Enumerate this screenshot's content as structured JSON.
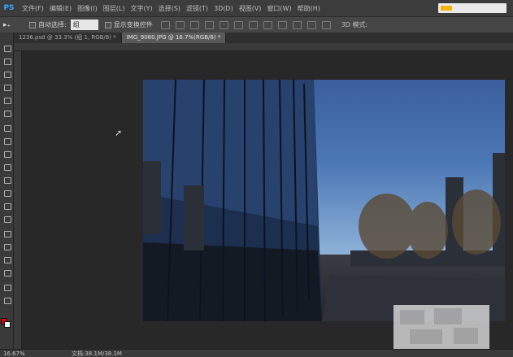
{
  "app": {
    "logo": "PS"
  },
  "menu": {
    "items": [
      "文件(F)",
      "编辑(E)",
      "图像(I)",
      "图层(L)",
      "文字(Y)",
      "选择(S)",
      "滤镜(T)",
      "3D(D)",
      "视图(V)",
      "窗口(W)",
      "帮助(H)"
    ]
  },
  "options": {
    "tool_glyph": "▸₊",
    "auto_select_label": "自动选择:",
    "auto_select_value": "组",
    "show_transform_label": "显示变换控件",
    "mode_3d_label": "3D 模式:"
  },
  "tabs": [
    {
      "label": "1236.psd @ 33.3% (组 1, RGB/8) *",
      "active": false
    },
    {
      "label": "IMG_9060.JPG @ 16.7%(RGB/8) *",
      "active": true
    }
  ],
  "tools": [
    "move-icon",
    "marquee-icon",
    "lasso-icon",
    "quick-select-icon",
    "crop-icon",
    "eyedropper-icon",
    "healing-brush-icon",
    "brush-icon",
    "clone-stamp-icon",
    "history-brush-icon",
    "eraser-icon",
    "gradient-icon",
    "blur-icon",
    "dodge-icon",
    "pen-icon",
    "type-icon",
    "path-select-icon",
    "shape-icon",
    "hand-icon",
    "zoom-icon"
  ],
  "colors": {
    "foreground": "#e00000",
    "background": "#ffffff"
  },
  "status": {
    "zoom": "16.67%",
    "doc": "文档:38.1M/38.1M"
  }
}
